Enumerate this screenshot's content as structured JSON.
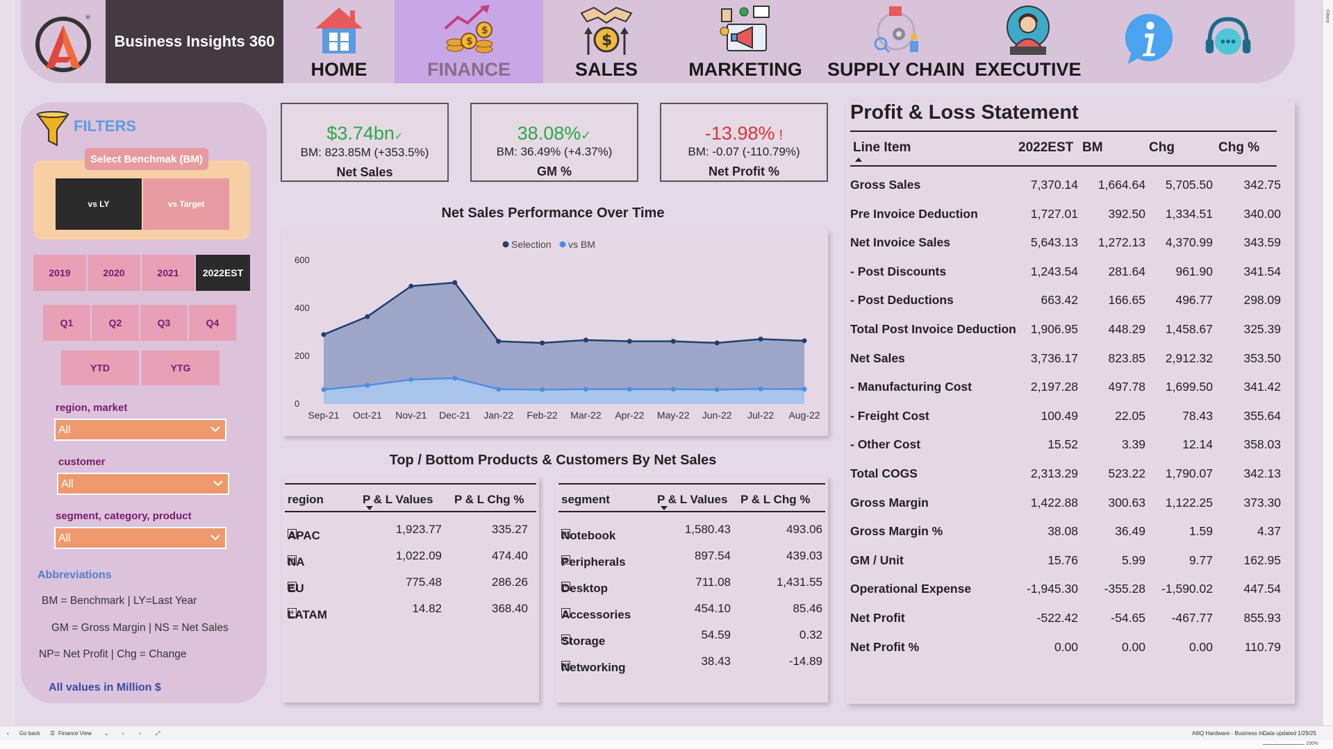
{
  "app": {
    "title": "Business Insights 360"
  },
  "nav": {
    "items": [
      {
        "label": "HOME",
        "icon": "home-icon"
      },
      {
        "label": "FINANCE",
        "icon": "finance-icon",
        "active": true
      },
      {
        "label": "SALES",
        "icon": "sales-icon"
      },
      {
        "label": "MARKETING",
        "icon": "marketing-icon"
      },
      {
        "label": "SUPPLY CHAIN",
        "icon": "supply-chain-icon"
      },
      {
        "label": "EXECUTIVE",
        "icon": "executive-icon"
      }
    ],
    "info_icon": "info-icon",
    "support_icon": "support-chat-icon"
  },
  "filters": {
    "title": "FILTERS",
    "benchmark_title": "Select Benchmak (BM)",
    "benchmark_options": [
      "vs LY",
      "vs Target"
    ],
    "benchmark_selected": "vs LY",
    "years": [
      "2019",
      "2020",
      "2021",
      "2022EST"
    ],
    "year_selected": "2022EST",
    "quarters": [
      "Q1",
      "Q2",
      "Q3",
      "Q4"
    ],
    "periods": [
      "YTD",
      "YTG"
    ],
    "slicers": [
      {
        "label": "region, market",
        "value": "All"
      },
      {
        "label": "customer",
        "value": "All"
      },
      {
        "label": "segment, category, product",
        "value": "All"
      }
    ],
    "abbreviations_title": "Abbreviations",
    "abbreviations": [
      "BM = Benchmark | LY=Last Year",
      "GM = Gross Margin | NS = Net Sales",
      "NP= Net Profit | Chg = Change"
    ],
    "units_note": "All values in Million $"
  },
  "kpis": [
    {
      "value": "$3.74bn",
      "mark": "✓",
      "status": "good",
      "bm": "BM: 823.85M (+353.5%)",
      "name": "Net Sales"
    },
    {
      "value": "38.08%",
      "mark": "✓",
      "status": "good",
      "bm": "BM: 36.49% (+4.37%)",
      "name": "GM %"
    },
    {
      "value": "-13.98%",
      "mark": "!",
      "status": "bad",
      "bm": "BM: -0.07 (-110.79%)",
      "name": "Net Profit %"
    }
  ],
  "chart_title": "Net Sales Performance Over Time",
  "chart_data": {
    "type": "area",
    "categories": [
      "Sep-21",
      "Oct-21",
      "Nov-21",
      "Dec-21",
      "Jan-22",
      "Feb-22",
      "Mar-22",
      "Apr-22",
      "May-22",
      "Jun-22",
      "Jul-22",
      "Aug-22"
    ],
    "series": [
      {
        "name": "Selection",
        "color": "#1f3f6e",
        "values": [
          290,
          365,
          492,
          507,
          262,
          255,
          267,
          262,
          262,
          255,
          271,
          264
        ]
      },
      {
        "name": "vs BM",
        "color": "#4a90e2",
        "values": [
          60,
          78,
          102,
          108,
          62,
          60,
          62,
          62,
          62,
          60,
          63,
          62
        ]
      }
    ],
    "ylim": [
      0,
      600
    ],
    "yticks": [
      "0",
      "200",
      "400",
      "600"
    ],
    "legend": "top-center"
  },
  "tables_title": "Top / Bottom Products & Customers By Net Sales",
  "region_table": {
    "headers": [
      "region",
      "P & L Values",
      "P & L Chg %"
    ],
    "rows": [
      [
        "APAC",
        "1,923.77",
        "335.27"
      ],
      [
        "NA",
        "1,022.09",
        "474.40"
      ],
      [
        "EU",
        "775.48",
        "286.26"
      ],
      [
        "LATAM",
        "14.82",
        "368.40"
      ]
    ]
  },
  "segment_table": {
    "headers": [
      "segment",
      "P & L Values",
      "P & L Chg %"
    ],
    "rows": [
      [
        "Notebook",
        "1,580.43",
        "493.06"
      ],
      [
        "Peripherals",
        "897.54",
        "439.03"
      ],
      [
        "Desktop",
        "711.08",
        "1,431.55"
      ],
      [
        "Accessories",
        "454.10",
        "85.46"
      ],
      [
        "Storage",
        "54.59",
        "0.32"
      ],
      [
        "Networking",
        "38.43",
        "-14.89"
      ]
    ]
  },
  "pl": {
    "title": "Profit & Loss Statement",
    "headers": [
      "Line Item",
      "2022EST",
      "BM",
      "Chg",
      "Chg %"
    ],
    "rows": [
      [
        "Gross Sales",
        "7,370.14",
        "1,664.64",
        "5,705.50",
        "342.75"
      ],
      [
        "Pre Invoice Deduction",
        "1,727.01",
        "392.50",
        "1,334.51",
        "340.00"
      ],
      [
        "Net Invoice Sales",
        "5,643.13",
        "1,272.13",
        "4,370.99",
        "343.59"
      ],
      [
        "- Post Discounts",
        "1,243.54",
        "281.64",
        "961.90",
        "341.54"
      ],
      [
        "- Post Deductions",
        "663.42",
        "166.65",
        "496.77",
        "298.09"
      ],
      [
        "Total Post Invoice Deduction",
        "1,906.95",
        "448.29",
        "1,458.67",
        "325.39"
      ],
      [
        "Net Sales",
        "3,736.17",
        "823.85",
        "2,912.32",
        "353.50"
      ],
      [
        "- Manufacturing Cost",
        "2,197.28",
        "497.78",
        "1,699.50",
        "341.42"
      ],
      [
        "- Freight Cost",
        "100.49",
        "22.05",
        "78.43",
        "355.64"
      ],
      [
        "- Other Cost",
        "15.52",
        "3.39",
        "12.14",
        "358.03"
      ],
      [
        "Total COGS",
        "2,313.29",
        "523.22",
        "1,790.07",
        "342.13"
      ],
      [
        "Gross Margin",
        "1,422.88",
        "300.63",
        "1,122.25",
        "373.30"
      ],
      [
        "Gross Margin %",
        "38.08",
        "36.49",
        "1.59",
        "4.37"
      ],
      [
        "GM / Unit",
        "15.76",
        "5.99",
        "9.77",
        "162.95"
      ],
      [
        "Operational Expense",
        "-1,945.30",
        "-355.28",
        "-1,590.02",
        "447.54"
      ],
      [
        "Net Profit",
        "-522.42",
        "-54.65",
        "-467.77",
        "855.93"
      ],
      [
        "Net Profit %",
        "0.00",
        "0.00",
        "0.00",
        "110.79"
      ]
    ]
  },
  "statusbar": {
    "back": "Go back",
    "page": "Finance View",
    "file": "AtliQ Hardware - Business In...",
    "updated": "Data updated 1/29/25",
    "zoom": "100%"
  },
  "side_pane_label": "Filters"
}
